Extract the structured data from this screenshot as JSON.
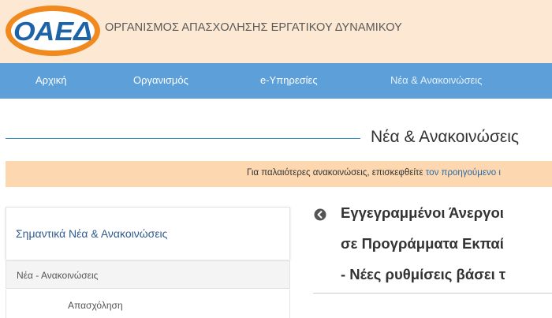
{
  "header": {
    "logo_text": "ΟΑΕΔ",
    "org_name": "ΟΡΓΑΝΙΣΜΟΣ ΑΠΑΣΧΟΛΗΣΗΣ ΕΡΓΑΤΙΚΟΥ ΔΥΝΑΜΙΚΟΥ"
  },
  "nav": {
    "items": [
      {
        "label": "Αρχική"
      },
      {
        "label": "Οργανισμός"
      },
      {
        "label": "e-Υπηρεσίες"
      },
      {
        "label": "Νέα & Ανακοινώσεις",
        "active": true
      }
    ]
  },
  "section": {
    "title": "Νέα & Ανακοινώσεις"
  },
  "notice": {
    "text": "Για παλαιότερες ανακοινώσεις, επισκεφθείτε",
    "link_text": "τον προηγούμενο ι"
  },
  "sidebar": {
    "heading": "Σημαντικά Νέα & Ανακοινώσεις",
    "category": "Νέα - Ανακοινώσεις",
    "subcategory": "Απασχόληση"
  },
  "article": {
    "back_icon": "circle-arrow-left-icon",
    "title_lines": [
      "Εγγεγραμμένοι Άνεργοι",
      "σε Προγράμματα Εκπαί",
      "- Νέες ρυθμίσεις βάσει τ"
    ]
  },
  "colors": {
    "header_bg": "#fde9d3",
    "nav_bg": "#5d9fd9",
    "notice_bg": "#fcd7b0",
    "logo_blue": "#1c63a8",
    "logo_orange": "#f08a1e",
    "accent_line": "#2d8fc7"
  }
}
